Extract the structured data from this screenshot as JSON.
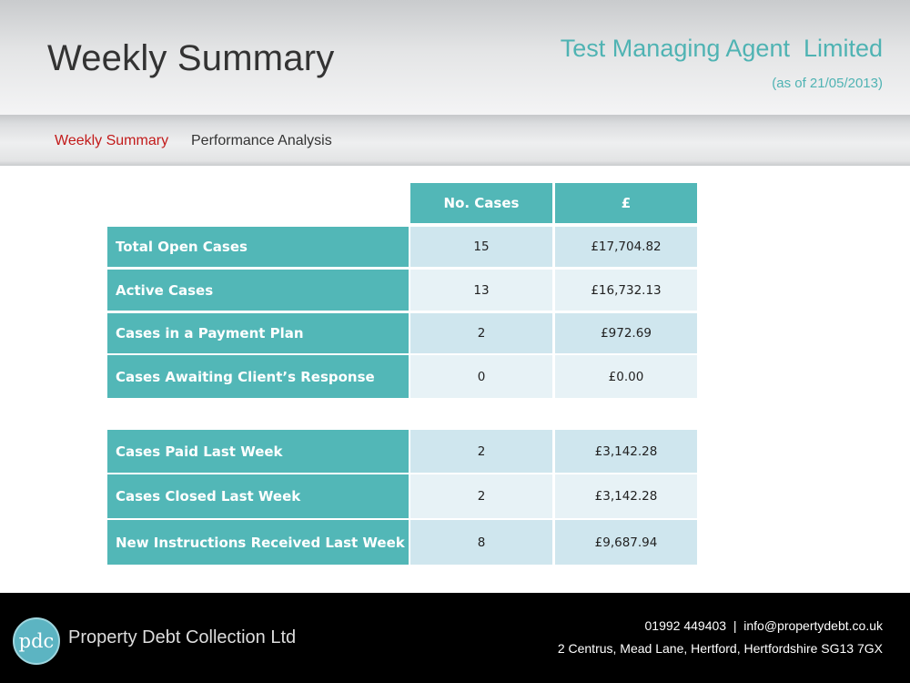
{
  "header": {
    "title": "Weekly Summary",
    "company": "Test Managing Agent  Limited",
    "as_of": "(as of 21/05/2013)"
  },
  "nav": {
    "items": [
      {
        "label": "Weekly Summary",
        "active": true
      },
      {
        "label": "Performance Analysis",
        "active": false
      }
    ]
  },
  "table": {
    "headers": {
      "cases": "No. Cases",
      "amount": "£"
    },
    "group1": [
      {
        "label": "Total Open Cases",
        "cases": "15",
        "amount": "£17,704.82"
      },
      {
        "label": "Active Cases",
        "cases": "13",
        "amount": "£16,732.13"
      },
      {
        "label": "Cases in a Payment Plan",
        "cases": "2",
        "amount": "£972.69"
      },
      {
        "label": "Cases Awaiting Client’s Response",
        "cases": "0",
        "amount": "£0.00"
      }
    ],
    "group2": [
      {
        "label": "Cases Paid Last Week",
        "cases": "2",
        "amount": "£3,142.28"
      },
      {
        "label": "Cases Closed Last Week",
        "cases": "2",
        "amount": "£3,142.28"
      },
      {
        "label": "New Instructions Received Last Week",
        "cases": "8",
        "amount": "£9,687.94"
      }
    ]
  },
  "footer": {
    "logo_text": "pdc",
    "company": "Property Debt Collection Ltd",
    "contact": "01992 449403  |  info@propertydebt.co.uk",
    "address": "2 Centrus, Mead Lane, Hertford, Hertfordshire SG13 7GX"
  },
  "colors": {
    "accent": "#52b7b7",
    "active_nav": "#c21a1a",
    "cell_dark": "#cfe6ee",
    "cell_light": "#e7f2f6"
  }
}
